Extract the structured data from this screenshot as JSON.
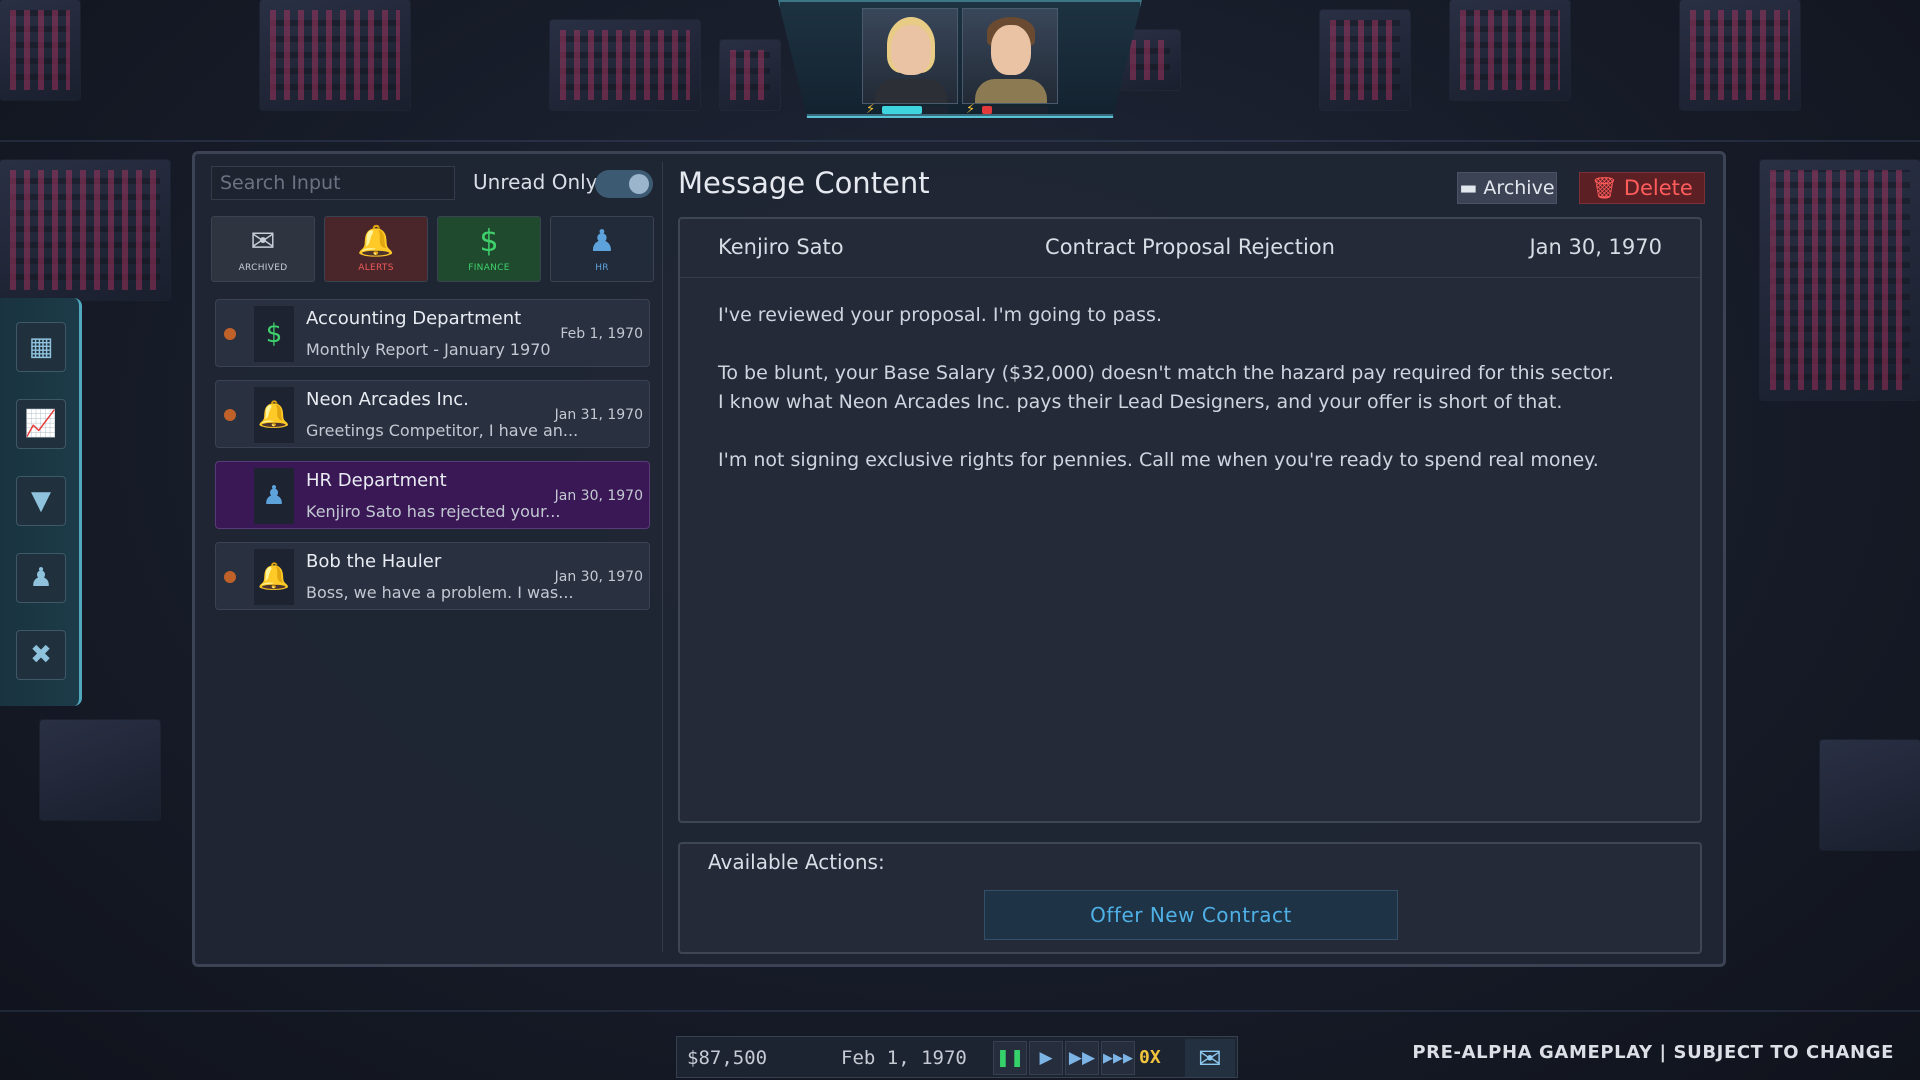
{
  "portraits": [
    {
      "name": "blonde-woman",
      "energy": 0.6,
      "energy_color": "#3fd5e0"
    },
    {
      "name": "brown-haired-man",
      "energy": 0.15,
      "energy_color": "#e23a3a"
    }
  ],
  "leftbar": {
    "tools": [
      "buildings-icon",
      "growth-chart-icon",
      "tie-icon",
      "org-chart-icon",
      "crossed-tools-icon"
    ]
  },
  "inbox": {
    "search_placeholder": "Search Input",
    "unread_label": "Unread Only",
    "unread_only": true,
    "categories": [
      {
        "label": "ARCHIVED",
        "icon": "envelope-icon"
      },
      {
        "label": "ALERTS",
        "icon": "bell-icon"
      },
      {
        "label": "FINANCE",
        "icon": "dollar-icon"
      },
      {
        "label": "HR",
        "icon": "people-icon"
      }
    ],
    "messages": [
      {
        "sender": "Accounting Department",
        "preview": "Monthly Report - January 1970",
        "date": "Feb 1, 1970",
        "unread": true,
        "icon": "dollar-icon",
        "color": "#3fd06c"
      },
      {
        "sender": "Neon Arcades Inc.",
        "preview": "Greetings Competitor, I have an...",
        "date": "Jan 31, 1970",
        "unread": true,
        "icon": "bell-icon",
        "color": "#ef5b5b"
      },
      {
        "sender": "HR Department",
        "preview": "Kenjiro Sato has rejected your...",
        "date": "Jan 30, 1970",
        "unread": false,
        "selected": true,
        "icon": "people-icon",
        "color": "#5ea2dc"
      },
      {
        "sender": "Bob the Hauler",
        "preview": "Boss, we have a problem. I was...",
        "date": "Jan 30, 1970",
        "unread": true,
        "icon": "bell-icon",
        "color": "#ef5b5b"
      }
    ]
  },
  "message": {
    "title": "Message Content",
    "archive_label": "Archive",
    "delete_label": "Delete",
    "sender": "Kenjiro Sato",
    "subject": "Contract Proposal Rejection",
    "date": "Jan 30, 1970",
    "paragraphs": [
      "I've reviewed your proposal. I'm going to pass.",
      "To be blunt, your Base Salary ($32,000) doesn't match the hazard pay required for this sector.\nI know what Neon Arcades Inc. pays their Lead Designers, and your offer is short of that.",
      "I'm not signing exclusive rights for pennies. Call me when you're ready to spend real money."
    ],
    "actions_label": "Available Actions:",
    "offer_button": "Offer New Contract"
  },
  "status": {
    "money": "$87,500",
    "date": "Feb 1, 1970",
    "speed": "0X",
    "footer": "PRE-ALPHA GAMEPLAY | SUBJECT TO CHANGE"
  }
}
